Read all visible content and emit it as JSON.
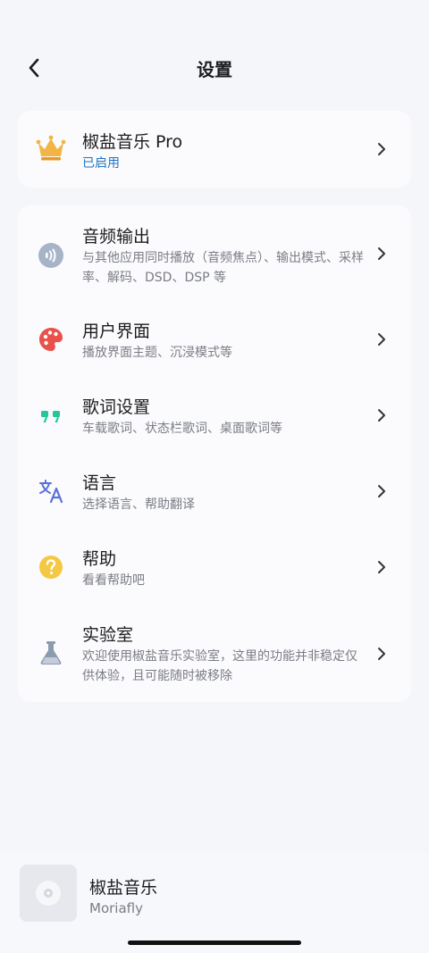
{
  "header": {
    "title": "设置"
  },
  "pro": {
    "title": "椒盐音乐 Pro",
    "status": "已启用"
  },
  "items": [
    {
      "title": "音频输出",
      "sub": "与其他应用同时播放（音频焦点）、输出模式、采样率、解码、DSD、DSP 等",
      "icon": "speaker-icon"
    },
    {
      "title": "用户界面",
      "sub": "播放界面主题、沉浸模式等",
      "icon": "palette-icon"
    },
    {
      "title": "歌词设置",
      "sub": "车载歌词、状态栏歌词、桌面歌词等",
      "icon": "quote-icon"
    },
    {
      "title": "语言",
      "sub": "选择语言、帮助翻译",
      "icon": "translate-icon"
    },
    {
      "title": "帮助",
      "sub": "看看帮助吧",
      "icon": "help-icon"
    },
    {
      "title": "实验室",
      "sub": "欢迎使用椒盐音乐实验室，这里的功能并非稳定仅供体验，且可能随时被移除",
      "icon": "flask-icon"
    }
  ],
  "player": {
    "title": "椒盐音乐",
    "artist": "Moriafly"
  },
  "colors": {
    "accent": "#1f72c4",
    "crown": "#f2b544",
    "palette": "#e8524a",
    "quote": "#1fc99a",
    "translate": "#5a6fd8",
    "help": "#f4c842",
    "flask": "#8a9bb0",
    "speaker": "#a7b4c8"
  }
}
